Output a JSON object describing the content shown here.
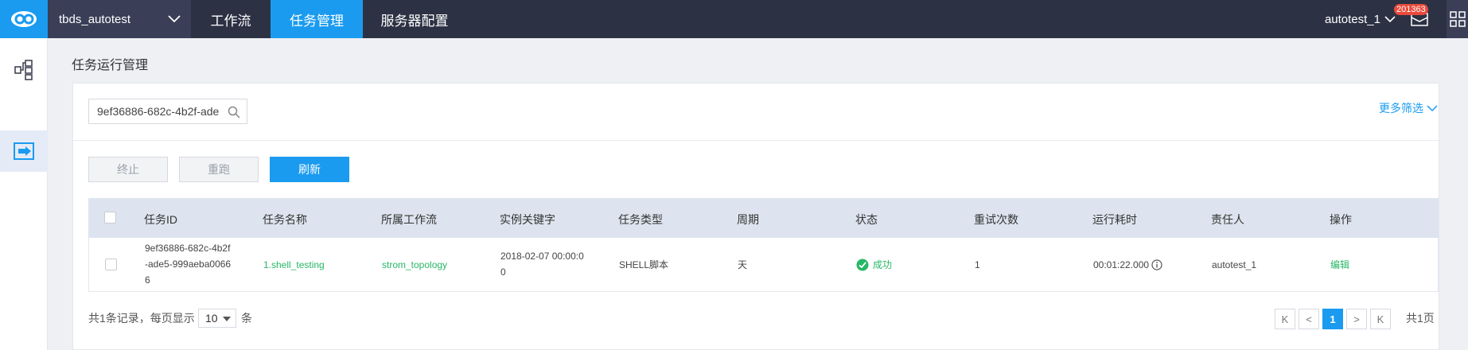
{
  "topbar": {
    "project": "tbds_autotest",
    "tabs": [
      {
        "label": "工作流",
        "active": false
      },
      {
        "label": "任务管理",
        "active": true
      },
      {
        "label": "服务器配置",
        "active": false
      }
    ],
    "user": "autotest_1",
    "notification_count": "201363"
  },
  "sidebar": {
    "items": [
      {
        "icon": "workflow-icon",
        "active": false
      },
      {
        "icon": "list-icon",
        "active": false
      },
      {
        "icon": "task-run-icon",
        "active": true
      }
    ]
  },
  "page": {
    "title": "任务运行管理"
  },
  "filters": {
    "search_value": "9ef36886-682c-4b2f-ade",
    "more_filters": "更多筛选"
  },
  "toolbar": {
    "stop": "终止",
    "rerun": "重跑",
    "refresh": "刷新"
  },
  "table": {
    "columns": [
      "任务ID",
      "任务名称",
      "所属工作流",
      "实例关键字",
      "任务类型",
      "周期",
      "状态",
      "重试次数",
      "运行耗时",
      "责任人",
      "操作"
    ],
    "rows": [
      {
        "id_lines": [
          "9ef36886-682c-4b2f",
          "-ade5-999aeba0066",
          "6"
        ],
        "name": "1.shell_testing",
        "workflow": "strom_topology",
        "instance_key_lines": [
          "2018-02-07 00:00:0",
          "0"
        ],
        "type": "SHELL脚本",
        "cycle": "天",
        "status": "成功",
        "retries": "1",
        "duration": "00:01:22.000",
        "owner": "autotest_1",
        "action": "编辑"
      }
    ]
  },
  "pagination": {
    "total_records": "共1条记录，每页显示",
    "page_size": "10",
    "unit": "条",
    "current_page": "1",
    "total_pages": "共1页",
    "first": "K",
    "prev": "<",
    "next": ">",
    "last": "K"
  },
  "colors": {
    "accent": "#1a9bf0",
    "success": "#27b766",
    "topbar": "#2d3144"
  }
}
